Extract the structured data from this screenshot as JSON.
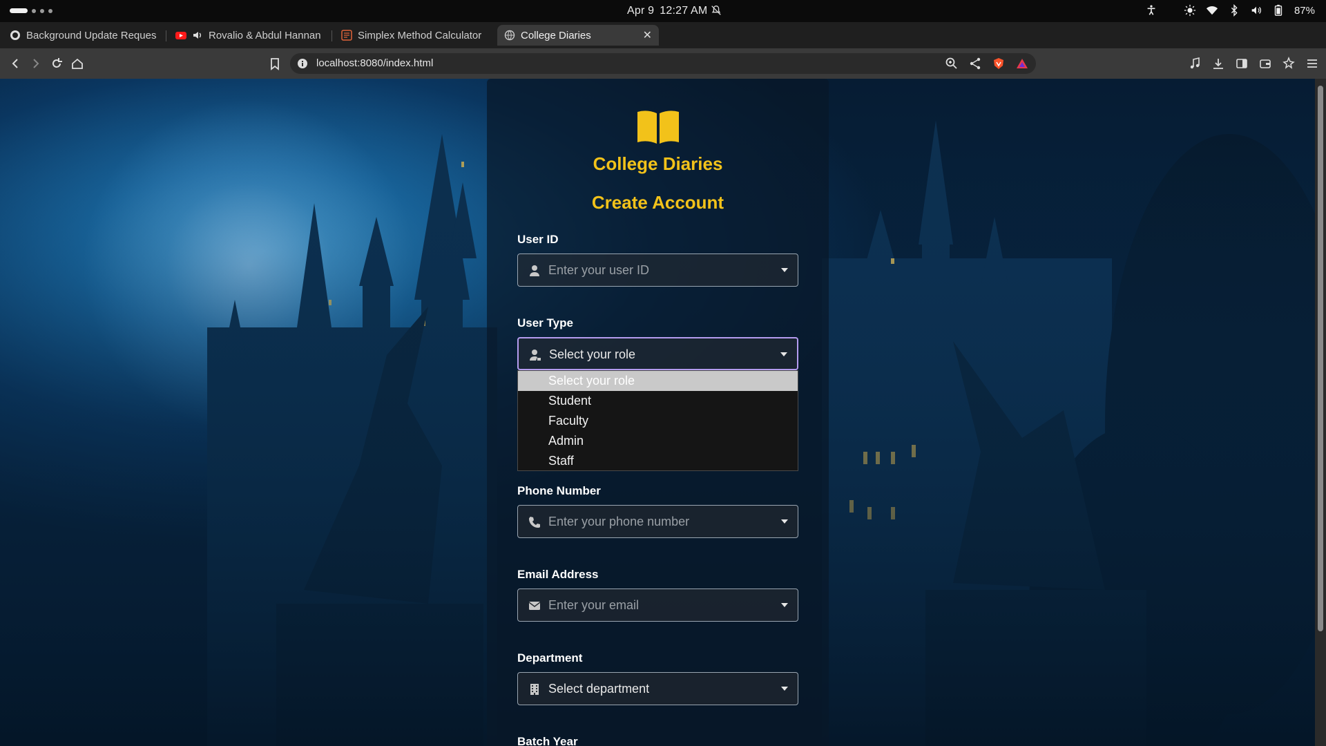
{
  "os": {
    "date": "Apr 9",
    "time": "12:27 AM",
    "battery": "87%"
  },
  "tabs": [
    {
      "title": "Background Update Reques"
    },
    {
      "title": "Rovalio & Abdul Hannan"
    },
    {
      "title": "Simplex Method Calculator"
    },
    {
      "title": "College Diaries"
    }
  ],
  "address_bar": {
    "url": "localhost:8080/index.html"
  },
  "page": {
    "brand": "College Diaries",
    "heading": "Create Account",
    "fields": {
      "user_id": {
        "label": "User ID",
        "placeholder": "Enter your user ID"
      },
      "user_type": {
        "label": "User Type",
        "value": "Select your role"
      },
      "phone": {
        "label": "Phone Number",
        "placeholder": "Enter your phone number"
      },
      "email": {
        "label": "Email Address",
        "placeholder": "Enter your email"
      },
      "department": {
        "label": "Department",
        "value": "Select department"
      },
      "batch_year": {
        "label": "Batch Year"
      }
    },
    "role_options": [
      "Select your role",
      "Student",
      "Faculty",
      "Admin",
      "Staff"
    ]
  },
  "colors": {
    "accent": "#f2c21a",
    "focus_border": "#b59cf0"
  }
}
